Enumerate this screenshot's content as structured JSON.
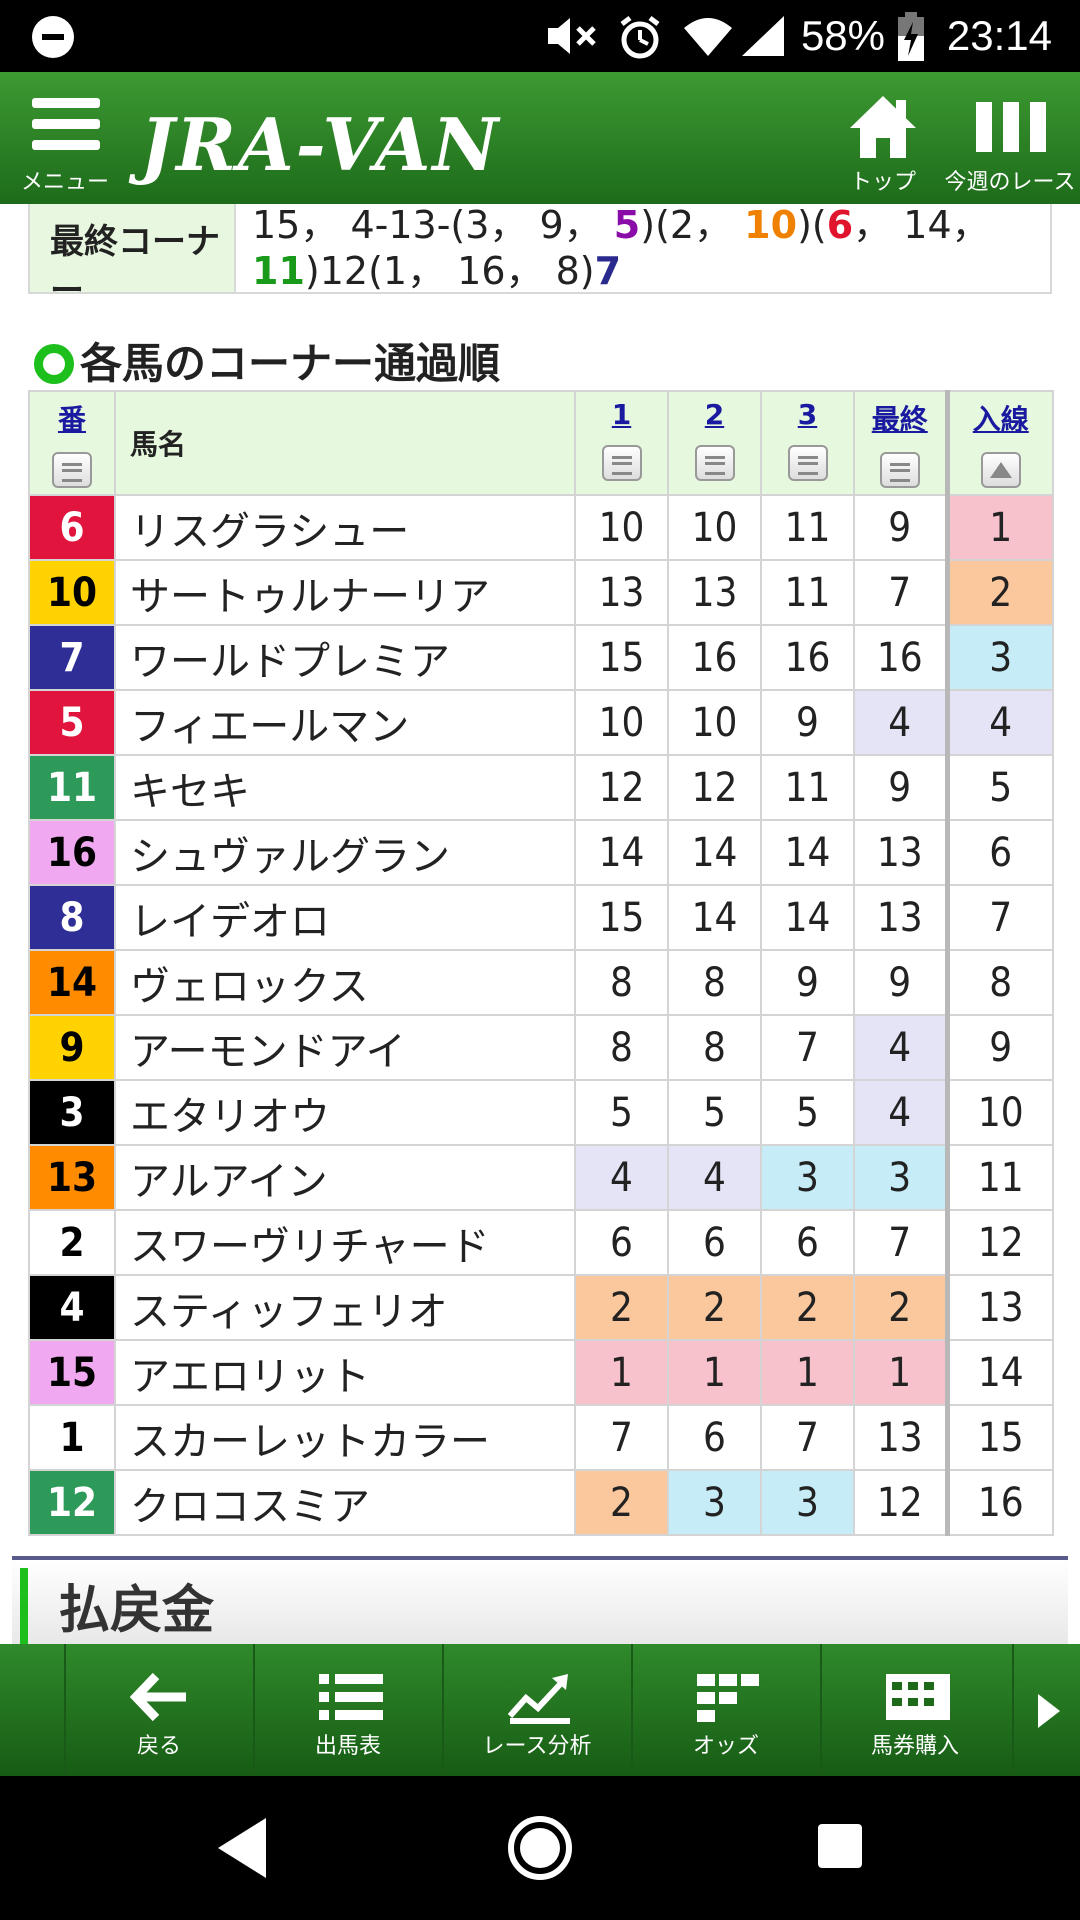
{
  "status_bar": {
    "battery_percent": "58%",
    "time": "23:14",
    "icons": [
      "dnd-icon",
      "mute-icon",
      "alarm-icon",
      "wifi-icon",
      "signal-icon",
      "battery-charging-icon"
    ]
  },
  "header": {
    "menu_label": "メニュー",
    "logo_text": "JRA-VAN",
    "home_label": "トップ",
    "week_label": "今週のレース"
  },
  "corner_summary": {
    "label": "最終コーナー",
    "line1": [
      "15，",
      "4-13-(3，",
      "9，",
      "5",
      ")(2，",
      "10",
      ")(",
      "6",
      "，",
      "14，"
    ],
    "line2": [
      "11",
      ")12(1，",
      "16，",
      "8)",
      "7"
    ]
  },
  "section": {
    "title": "各馬のコーナー通過順"
  },
  "table": {
    "headers": {
      "number": "番",
      "name": "馬名",
      "c1": "1",
      "c2": "2",
      "c3": "3",
      "final": "最終",
      "finish": "入線"
    },
    "rows": [
      {
        "num": "6",
        "name": "リスグラシュー",
        "c1": "10",
        "c2": "10",
        "c3": "11",
        "final": "9",
        "finish": "1"
      },
      {
        "num": "10",
        "name": "サートゥルナーリア",
        "c1": "13",
        "c2": "13",
        "c3": "11",
        "final": "7",
        "finish": "2"
      },
      {
        "num": "7",
        "name": "ワールドプレミア",
        "c1": "15",
        "c2": "16",
        "c3": "16",
        "final": "16",
        "finish": "3"
      },
      {
        "num": "5",
        "name": "フィエールマン",
        "c1": "10",
        "c2": "10",
        "c3": "9",
        "final": "4",
        "finish": "4"
      },
      {
        "num": "11",
        "name": "キセキ",
        "c1": "12",
        "c2": "12",
        "c3": "11",
        "final": "9",
        "finish": "5"
      },
      {
        "num": "16",
        "name": "シュヴァルグラン",
        "c1": "14",
        "c2": "14",
        "c3": "14",
        "final": "13",
        "finish": "6"
      },
      {
        "num": "8",
        "name": "レイデオロ",
        "c1": "15",
        "c2": "14",
        "c3": "14",
        "final": "13",
        "finish": "7"
      },
      {
        "num": "14",
        "name": "ヴェロックス",
        "c1": "8",
        "c2": "8",
        "c3": "9",
        "final": "9",
        "finish": "8"
      },
      {
        "num": "9",
        "name": "アーモンドアイ",
        "c1": "8",
        "c2": "8",
        "c3": "7",
        "final": "4",
        "finish": "9"
      },
      {
        "num": "3",
        "name": "エタリオウ",
        "c1": "5",
        "c2": "5",
        "c3": "5",
        "final": "4",
        "finish": "10"
      },
      {
        "num": "13",
        "name": "アルアイン",
        "c1": "4",
        "c2": "4",
        "c3": "3",
        "final": "3",
        "finish": "11"
      },
      {
        "num": "2",
        "name": "スワーヴリチャード",
        "c1": "6",
        "c2": "6",
        "c3": "6",
        "final": "7",
        "finish": "12"
      },
      {
        "num": "4",
        "name": "スティッフェリオ",
        "c1": "2",
        "c2": "2",
        "c3": "2",
        "final": "2",
        "finish": "13"
      },
      {
        "num": "15",
        "name": "アエロリット",
        "c1": "1",
        "c2": "1",
        "c3": "1",
        "final": "1",
        "finish": "14"
      },
      {
        "num": "1",
        "name": "スカーレットカラー",
        "c1": "7",
        "c2": "6",
        "c3": "7",
        "final": "13",
        "finish": "15"
      },
      {
        "num": "12",
        "name": "クロコスミア",
        "c1": "2",
        "c2": "3",
        "c3": "3",
        "final": "12",
        "finish": "16"
      }
    ]
  },
  "payout": {
    "title": "払戻金"
  },
  "toolbar": {
    "back": "戻る",
    "entries": "出馬表",
    "analysis": "レース分析",
    "odds": "オッズ",
    "purchase": "馬券購入"
  }
}
